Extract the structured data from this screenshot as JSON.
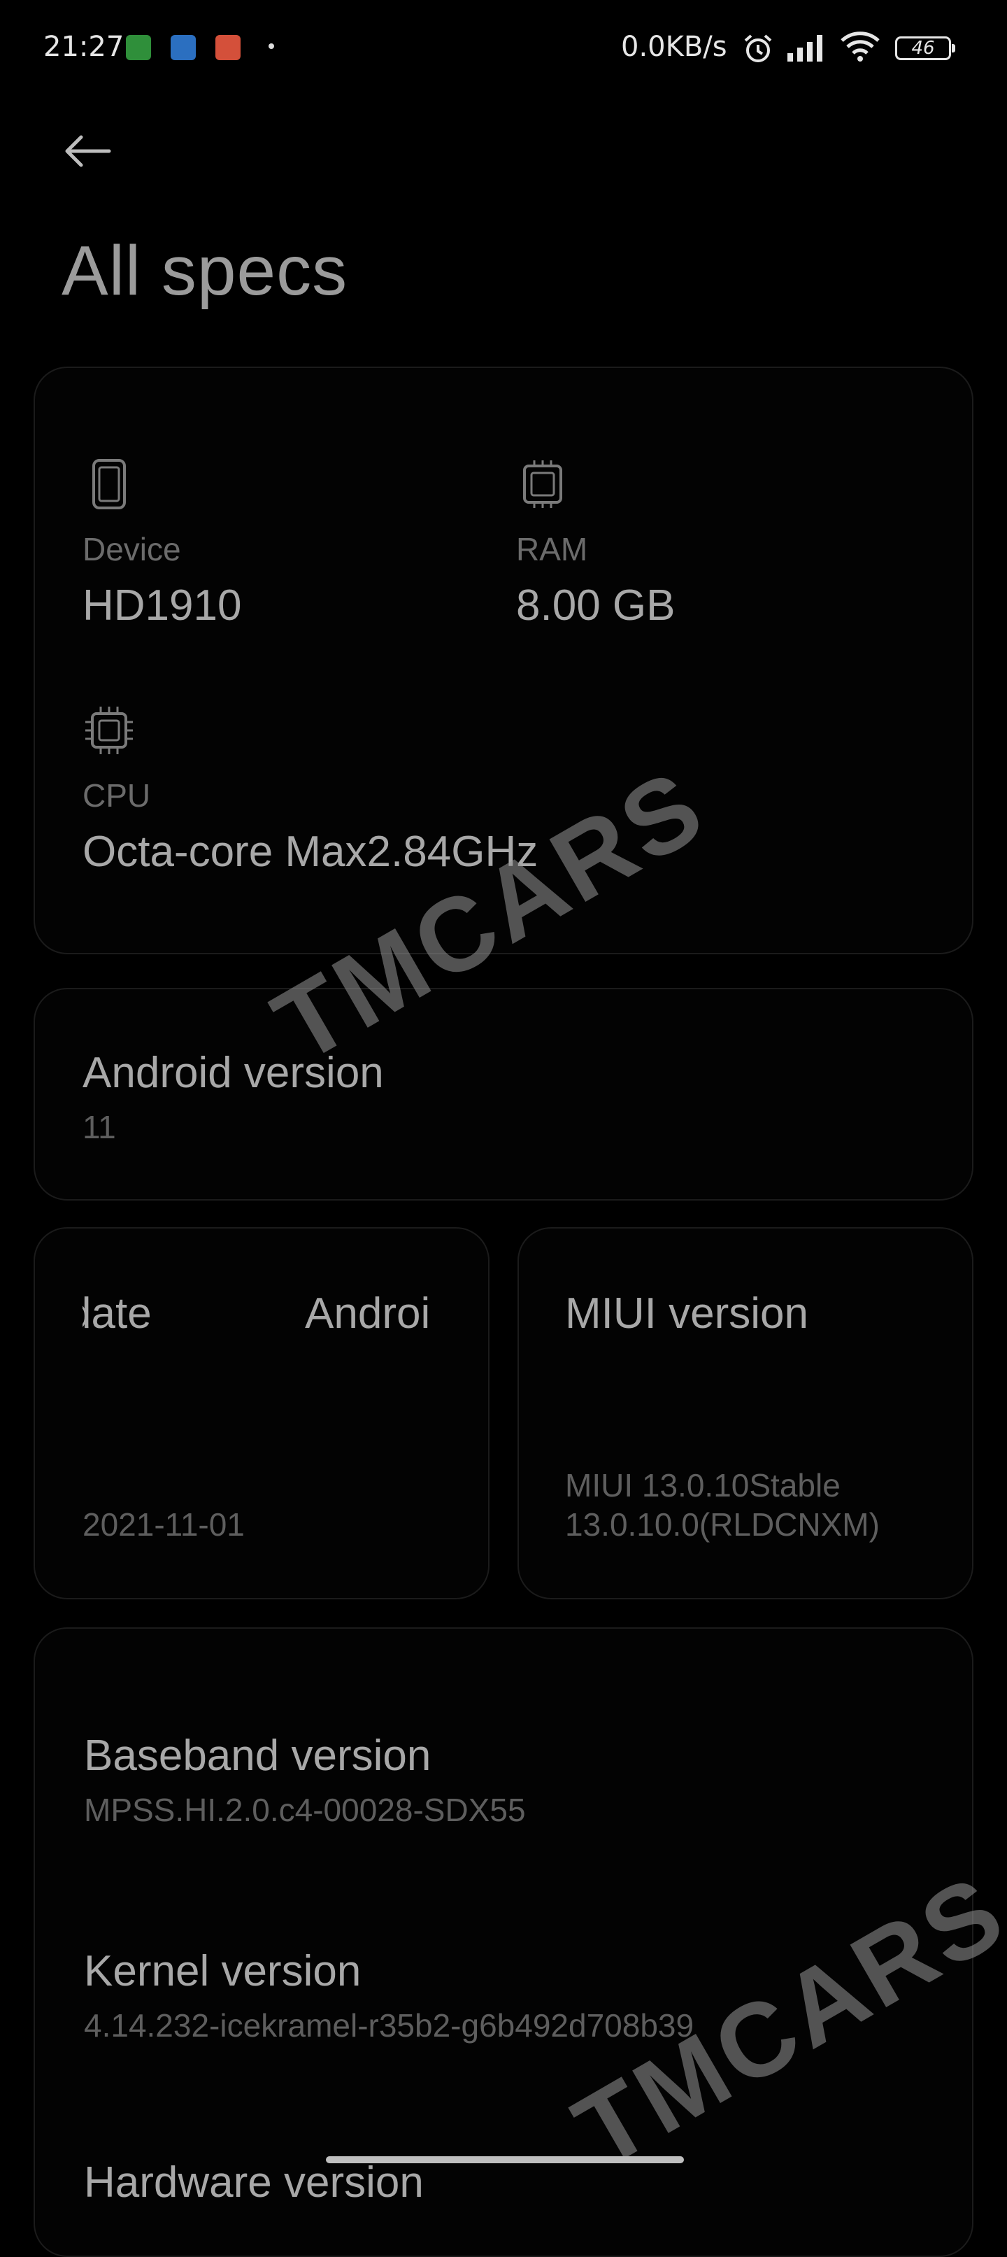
{
  "status_bar": {
    "time": "21:27",
    "net_speed": "0.0KB/s",
    "battery": "46"
  },
  "header": {
    "title": "All specs"
  },
  "specs": {
    "device": {
      "label": "Device",
      "value": "HD1910"
    },
    "ram": {
      "label": "RAM",
      "value": "8.00 GB"
    },
    "cpu": {
      "label": "CPU",
      "value": "Octa-core Max2.84GHz"
    }
  },
  "android": {
    "title": "Android version",
    "value": "11"
  },
  "security_patch": {
    "title_part1": "date",
    "title_part2": "Androi",
    "value": "2021-11-01"
  },
  "miui": {
    "title": "MIUI version",
    "value_line1": "MIUI 13.0.10Stable",
    "value_line2": "13.0.10.0(RLDCNXM)"
  },
  "details": {
    "baseband": {
      "title": "Baseband version",
      "value": "MPSS.HI.2.0.c4-00028-SDX55"
    },
    "kernel": {
      "title": "Kernel version",
      "value": "4.14.232-icekramel-r35b2-g6b492d708b39"
    },
    "hardware": {
      "title": "Hardware version"
    }
  },
  "watermark": {
    "text": "TMCARS"
  },
  "colors": {
    "background": "#000000",
    "card_border": "#1b1b1b",
    "value_text": "#a8a8a8",
    "label_text": "#6b6b6b"
  }
}
